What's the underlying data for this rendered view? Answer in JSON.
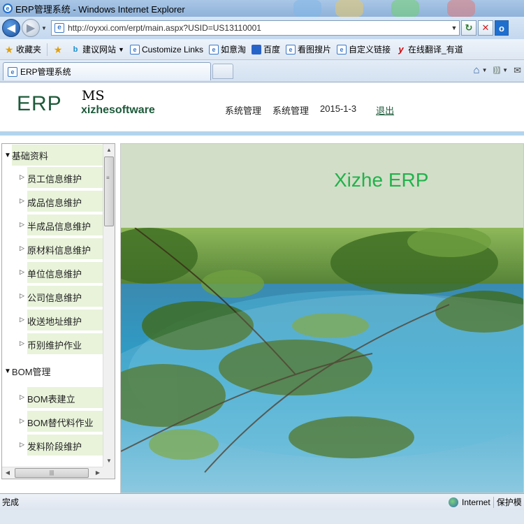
{
  "window": {
    "title": "ERP管理系统 - Windows Internet Explorer"
  },
  "address_bar": {
    "url": "http://oyxxi.com/erpt/main.aspx?USID=US13110001"
  },
  "favorites_bar": {
    "favorites_label": "收藏夹",
    "items": [
      {
        "icon": "bing-icon",
        "label": "建议网站"
      },
      {
        "icon": "ie-page-icon",
        "label": "Customize Links"
      },
      {
        "icon": "ie-page-icon",
        "label": "如意淘"
      },
      {
        "icon": "baidu-paw-icon",
        "label": "百度"
      },
      {
        "icon": "ie-page-icon",
        "label": "看图搜片"
      },
      {
        "icon": "ie-page-icon",
        "label": "自定义链接"
      },
      {
        "icon": "youdao-icon",
        "label": "在线翻译_有道"
      }
    ]
  },
  "tab": {
    "label": "ERP管理系统"
  },
  "header": {
    "logo_erp": "ERP",
    "logo_ms": "MS",
    "logo_sub": "xizhesoftware",
    "nav": [
      "系统管理",
      "系统管理",
      "2015-1-3"
    ],
    "logout": "退出",
    "accent_color": "#1d5a3a",
    "bar_color": "#b3d4ee"
  },
  "menu": {
    "groups": [
      {
        "label": "基础资料",
        "items": [
          "员工信息维护",
          "成品信息维护",
          "半成品信息维护",
          "原材料信息维护",
          "单位信息维护",
          "公司信息维护",
          "收送地址维护",
          "币别维护作业"
        ]
      },
      {
        "label": "BOM管理",
        "items": [
          "BOM表建立",
          "BOM替代料作业",
          "发料阶段维护"
        ]
      }
    ],
    "item_bg_color": "#e8f3da"
  },
  "main": {
    "banner_title": "Xizhe ERP",
    "banner_color": "#22b24c"
  },
  "status_bar": {
    "status": "完成",
    "zone": "Internet",
    "protected_mode": "保护模"
  }
}
